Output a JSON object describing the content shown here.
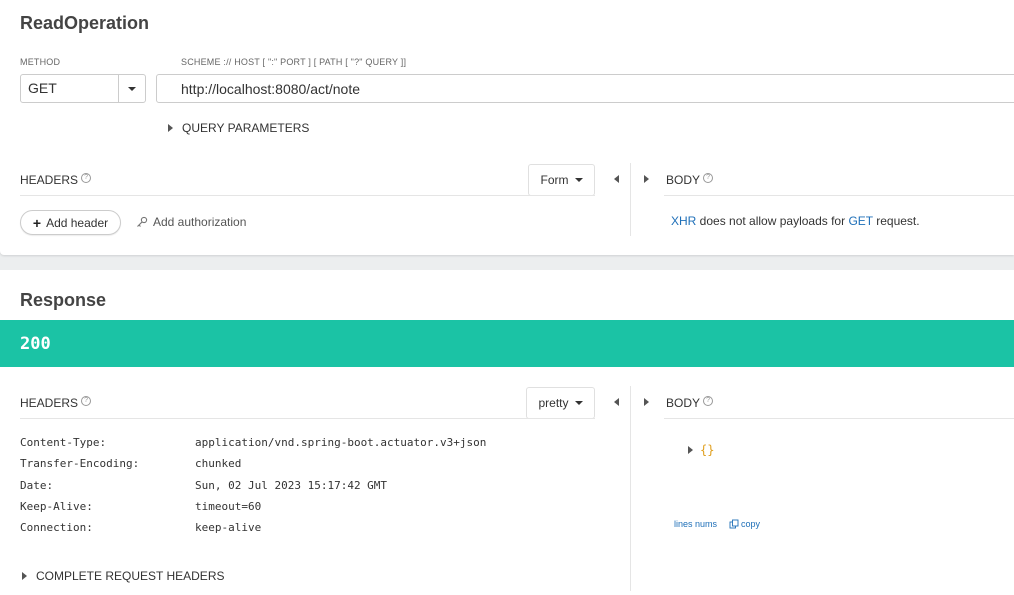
{
  "request": {
    "title": "ReadOperation",
    "method_label": "METHOD",
    "method_value": "GET",
    "url_label": "SCHEME :// HOST [ \":\" PORT ] [ PATH [ \"?\" QUERY ]]",
    "url_value": "http://localhost:8080/act/note",
    "query_params_label": "QUERY PARAMETERS",
    "headers_label": "HEADERS",
    "headers_format": "Form",
    "body_label": "BODY",
    "add_header_label": "Add header",
    "add_authorization_label": "Add authorization",
    "body_msg": {
      "xhr": "XHR",
      "middle": " does not allow payloads for ",
      "get": "GET",
      "end": " request."
    }
  },
  "response": {
    "title": "Response",
    "status_code": "200",
    "headers_label": "HEADERS",
    "headers_format": "pretty",
    "body_label": "BODY",
    "headers": [
      {
        "name": "Content-Type:",
        "value": "application/vnd.spring-boot.actuator.v3+json"
      },
      {
        "name": "Transfer-Encoding:",
        "value": "chunked"
      },
      {
        "name": "Date:",
        "value": "Sun, 02 Jul 2023 15:17:42 GMT"
      },
      {
        "name": "Keep-Alive:",
        "value": "timeout=60"
      },
      {
        "name": "Connection:",
        "value": "keep-alive"
      }
    ],
    "complete_request_headers_label": "COMPLETE REQUEST HEADERS",
    "body_json": "{}",
    "lines_nums_label": "lines nums",
    "copy_label": "copy"
  },
  "colors": {
    "status_success": "#1bc3a5",
    "link_blue": "#1e6fb8"
  },
  "icons": [
    "help-icon",
    "caret-down-icon",
    "triangle-right-icon",
    "triangle-left-icon",
    "plus-icon",
    "key-icon",
    "copy-icon"
  ]
}
